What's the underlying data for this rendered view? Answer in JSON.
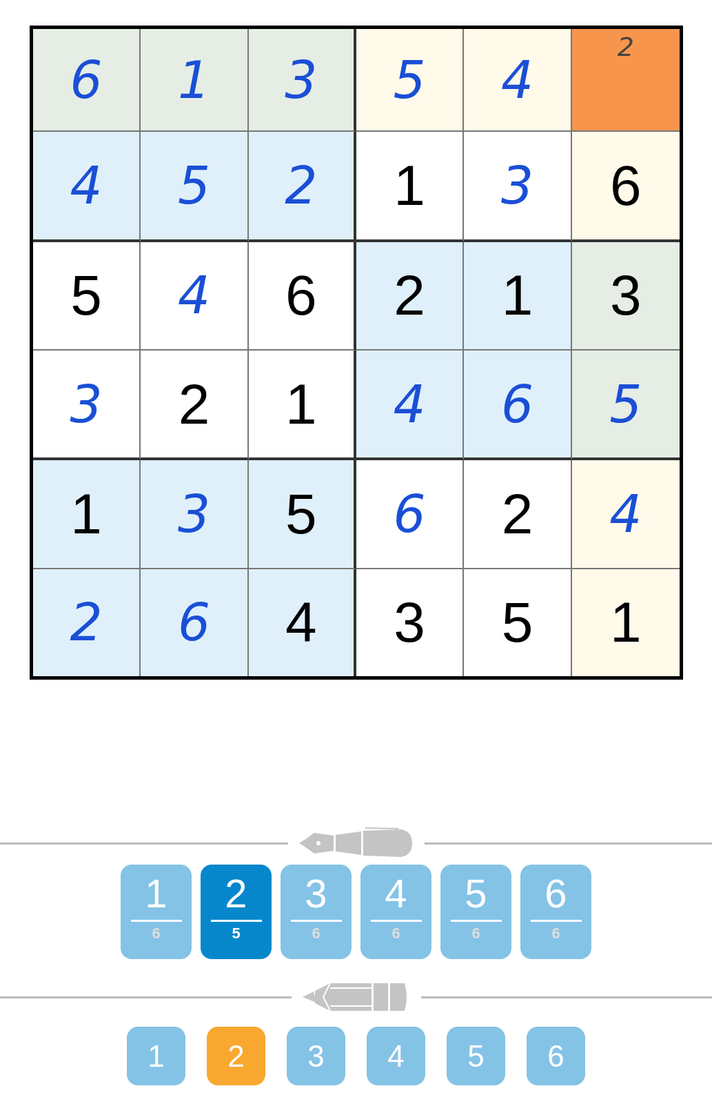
{
  "grid": [
    [
      {
        "value": "6",
        "kind": "entered",
        "color": "#e5ede5"
      },
      {
        "value": "1",
        "kind": "entered",
        "color": "#e5ede5"
      },
      {
        "value": "3",
        "kind": "entered",
        "color": "#e5ede5"
      },
      {
        "value": "5",
        "kind": "entered",
        "color": "#fffaea"
      },
      {
        "value": "4",
        "kind": "entered",
        "color": "#fffaea"
      },
      {
        "value": "2",
        "kind": "note",
        "color": "#f7954d"
      }
    ],
    [
      {
        "value": "4",
        "kind": "entered",
        "color": "#dff0fb"
      },
      {
        "value": "5",
        "kind": "entered",
        "color": "#dff0fb"
      },
      {
        "value": "2",
        "kind": "entered",
        "color": "#dff0fb"
      },
      {
        "value": "1",
        "kind": "given",
        "color": "#ffffff"
      },
      {
        "value": "3",
        "kind": "entered",
        "color": "#ffffff"
      },
      {
        "value": "6",
        "kind": "given",
        "color": "#fffaea"
      }
    ],
    [
      {
        "value": "5",
        "kind": "given",
        "color": "#ffffff"
      },
      {
        "value": "4",
        "kind": "entered",
        "color": "#ffffff"
      },
      {
        "value": "6",
        "kind": "given",
        "color": "#ffffff"
      },
      {
        "value": "2",
        "kind": "given",
        "color": "#dff0fb"
      },
      {
        "value": "1",
        "kind": "given",
        "color": "#dff0fb"
      },
      {
        "value": "3",
        "kind": "given",
        "color": "#e5ede5"
      }
    ],
    [
      {
        "value": "3",
        "kind": "entered",
        "color": "#ffffff"
      },
      {
        "value": "2",
        "kind": "given",
        "color": "#ffffff"
      },
      {
        "value": "1",
        "kind": "given",
        "color": "#ffffff"
      },
      {
        "value": "4",
        "kind": "entered",
        "color": "#dff0fb"
      },
      {
        "value": "6",
        "kind": "entered",
        "color": "#dff0fb"
      },
      {
        "value": "5",
        "kind": "entered",
        "color": "#e5ede5"
      }
    ],
    [
      {
        "value": "1",
        "kind": "given",
        "color": "#dff0fb"
      },
      {
        "value": "3",
        "kind": "entered",
        "color": "#dff0fb"
      },
      {
        "value": "5",
        "kind": "given",
        "color": "#dff0fb"
      },
      {
        "value": "6",
        "kind": "entered",
        "color": "#ffffff"
      },
      {
        "value": "2",
        "kind": "given",
        "color": "#ffffff"
      },
      {
        "value": "4",
        "kind": "entered",
        "color": "#fffaea"
      }
    ],
    [
      {
        "value": "2",
        "kind": "entered",
        "color": "#dff0fb"
      },
      {
        "value": "6",
        "kind": "entered",
        "color": "#dff0fb"
      },
      {
        "value": "4",
        "kind": "given",
        "color": "#dff0fb"
      },
      {
        "value": "3",
        "kind": "given",
        "color": "#ffffff"
      },
      {
        "value": "5",
        "kind": "given",
        "color": "#ffffff"
      },
      {
        "value": "1",
        "kind": "given",
        "color": "#fffaea"
      }
    ]
  ],
  "pen_buttons": [
    {
      "digit": "1",
      "count": "6",
      "selected": false
    },
    {
      "digit": "2",
      "count": "5",
      "selected": true
    },
    {
      "digit": "3",
      "count": "6",
      "selected": false
    },
    {
      "digit": "4",
      "count": "6",
      "selected": false
    },
    {
      "digit": "5",
      "count": "6",
      "selected": false
    },
    {
      "digit": "6",
      "count": "6",
      "selected": false
    }
  ],
  "pencil_buttons": [
    {
      "digit": "1",
      "selected": false
    },
    {
      "digit": "2",
      "selected": true
    },
    {
      "digit": "3",
      "selected": false
    },
    {
      "digit": "4",
      "selected": false
    },
    {
      "digit": "5",
      "selected": false
    },
    {
      "digit": "6",
      "selected": false
    }
  ]
}
